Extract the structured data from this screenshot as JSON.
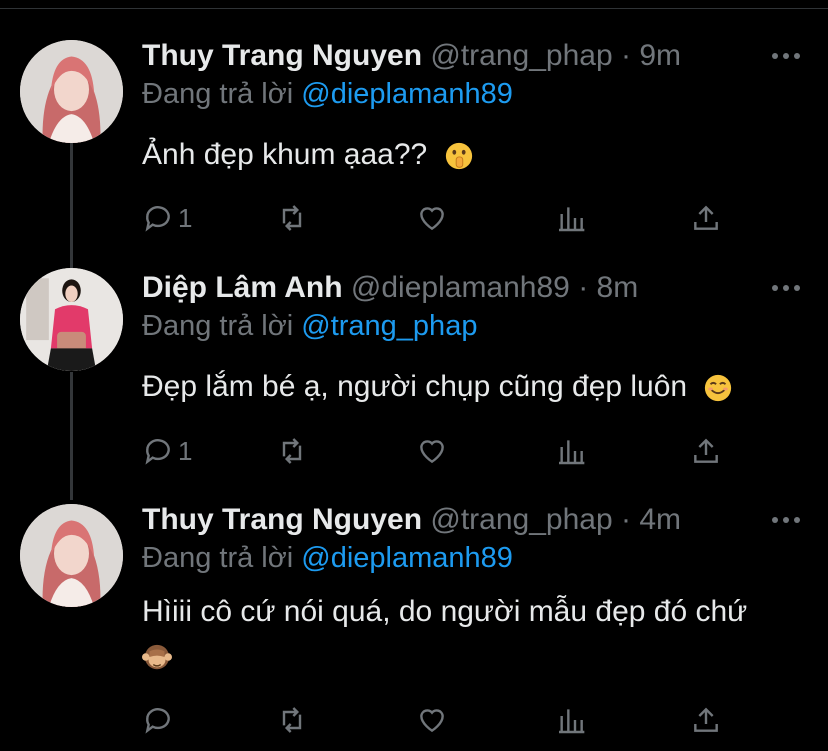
{
  "replying_prefix": "Đang trả lời",
  "tweets": [
    {
      "name": "Thuy Trang Nguyen",
      "handle": "@trang_phap",
      "separator": "·",
      "time": "9m",
      "replying_to": "@dieplamanh89",
      "text": "Ảnh đẹp khum ạaa??",
      "text_emoji": "shushing-face-emoji",
      "reply_count": "1"
    },
    {
      "name": "Diệp Lâm Anh",
      "handle": "@dieplamanh89",
      "separator": "·",
      "time": "8m",
      "replying_to": "@trang_phap",
      "text": "Đẹp lắm bé ạ, người chụp cũng đẹp luôn",
      "text_emoji": "smiling-face-emoji",
      "reply_count": "1"
    },
    {
      "name": "Thuy Trang Nguyen",
      "handle": "@trang_phap",
      "separator": "·",
      "time": "4m",
      "replying_to": "@dieplamanh89",
      "text": "Hìiii cô cứ nói quá, do người mẫu đẹp đó chứ",
      "text_emoji": "see-no-evil-monkey-emoji",
      "reply_count": ""
    }
  ],
  "colors": {
    "background": "#000000",
    "text": "#e7e9ea",
    "muted": "#71767b",
    "mention": "#1d9bf0",
    "thread_line": "#333639"
  }
}
